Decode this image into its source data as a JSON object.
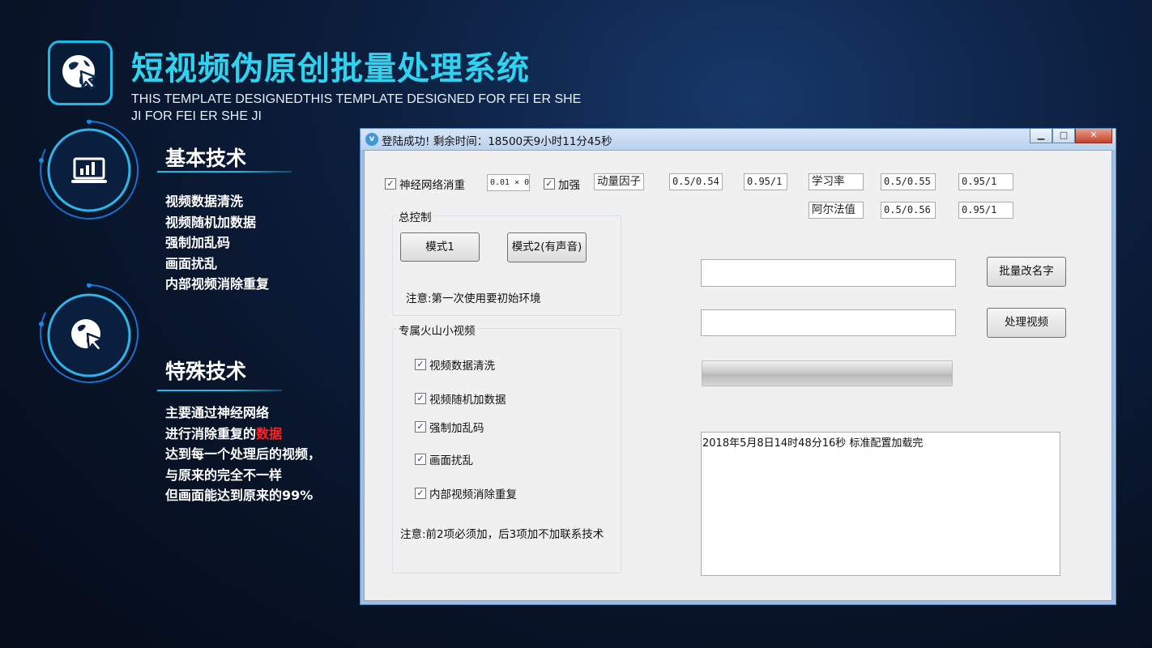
{
  "header": {
    "title": "短视频伪原创批量处理系统",
    "subtitle": "THIS TEMPLATE DESIGNEDTHIS TEMPLATE DESIGNED FOR FEI ER SHE JI FOR FEI ER SHE JI",
    "logo_icon": "globe-cursor-icon"
  },
  "sections": {
    "basic": {
      "icon": "laptop-chart-icon",
      "title": "基本技术",
      "items": [
        "视频数据清洗",
        "视频随机加数据",
        "强制加乱码",
        "画面扰乱",
        "内部视频消除重复"
      ]
    },
    "special": {
      "icon": "globe-cursor-icon",
      "title": "特殊技术",
      "line1": "主要通过神经网络",
      "line2_pre": "进行消除重复的",
      "line2_red": "数据",
      "line3": "达到每一个处理后的视频，",
      "line4": "与原来的完全不一样",
      "line5": "但画面能达到原来的99%"
    }
  },
  "window": {
    "title": "登陆成功! 剩余时间：18500天9小时11分45秒",
    "title_icon_letter": "v",
    "buttons": {
      "minimize": "▁",
      "maximize": "□",
      "close": "✕"
    },
    "top_row": {
      "nn_checkbox_label": "神经网络消重",
      "nn_checked": true,
      "nn_value": "0.01 × 0",
      "boost_label": "加强",
      "boost_checked": true,
      "momentum_label": "动量因子",
      "momentum_v1": "0.5/0.54",
      "momentum_v2": "0.95/1",
      "lr_label": "学习率",
      "lr_v1": "0.5/0.55",
      "lr_v2": "0.95/1",
      "alpha_label": "阿尔法值",
      "alpha_v1": "0.5/0.56",
      "alpha_v2": "0.95/1"
    },
    "main_control": {
      "group_label": "总控制",
      "mode1": "模式1",
      "mode2": "模式2(有声音)",
      "note": "注意:第一次使用要初始环境"
    },
    "huoshan": {
      "group_label": "专属火山小视频",
      "options": [
        {
          "label": "视频数据清洗",
          "checked": true
        },
        {
          "label": "视频随机加数据",
          "checked": true
        },
        {
          "label": "强制加乱码",
          "checked": true
        },
        {
          "label": "画面扰乱",
          "checked": true
        },
        {
          "label": "内部视频消除重复",
          "checked": true
        }
      ],
      "note": "注意:前2项必须加，后3项加不加联系技术"
    },
    "rename_input_value": "",
    "rename_button": "批量改名字",
    "process_input_value": "",
    "process_button": "处理视频",
    "progress": 0,
    "log_text": "2018年5月8日14时48分16秒   标准配置加载完"
  }
}
